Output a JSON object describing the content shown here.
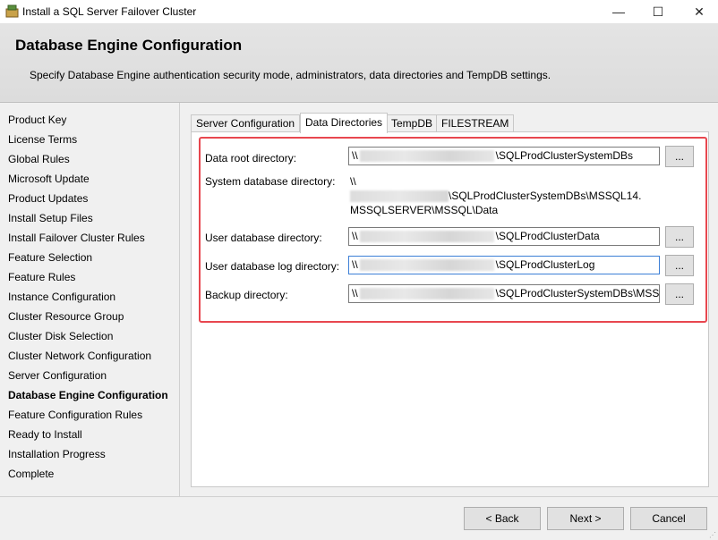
{
  "window": {
    "title": "Install a SQL Server Failover Cluster",
    "minimize": "—",
    "maximize": "☐",
    "close": "✕"
  },
  "header": {
    "title": "Database Engine Configuration",
    "description": "Specify Database Engine authentication security mode, administrators, data directories and TempDB settings."
  },
  "nav": {
    "items": [
      "Product Key",
      "License Terms",
      "Global Rules",
      "Microsoft Update",
      "Product Updates",
      "Install Setup Files",
      "Install Failover Cluster Rules",
      "Feature Selection",
      "Feature Rules",
      "Instance Configuration",
      "Cluster Resource Group",
      "Cluster Disk Selection",
      "Cluster Network Configuration",
      "Server Configuration",
      "Database Engine Configuration",
      "Feature Configuration Rules",
      "Ready to Install",
      "Installation Progress",
      "Complete"
    ],
    "active_index": 14
  },
  "tabs": [
    "Server Configuration",
    "Data Directories",
    "TempDB",
    "FILESTREAM"
  ],
  "active_tab": 1,
  "fields": {
    "data_root": {
      "label": "Data root directory:",
      "prefix": "\\\\",
      "suffix": "\\SQLProdClusterSystemDBs"
    },
    "system_db": {
      "label": "System database directory:",
      "line1": "\\\\",
      "line2_suffix": "\\SQLProdClusterSystemDBs\\MSSQL14.",
      "line3": "MSSQLSERVER\\MSSQL\\Data"
    },
    "user_db": {
      "label": "User database directory:",
      "prefix": "\\\\",
      "suffix": "\\SQLProdClusterData"
    },
    "user_log": {
      "label": "User database log directory:",
      "prefix": "\\\\",
      "suffix": "\\SQLProdClusterLog"
    },
    "backup": {
      "label": "Backup directory:",
      "prefix": "\\\\",
      "suffix": "\\SQLProdClusterSystemDBs\\MSSQ"
    }
  },
  "browse_label": "...",
  "buttons": {
    "back": "< Back",
    "next": "Next >",
    "cancel": "Cancel"
  }
}
